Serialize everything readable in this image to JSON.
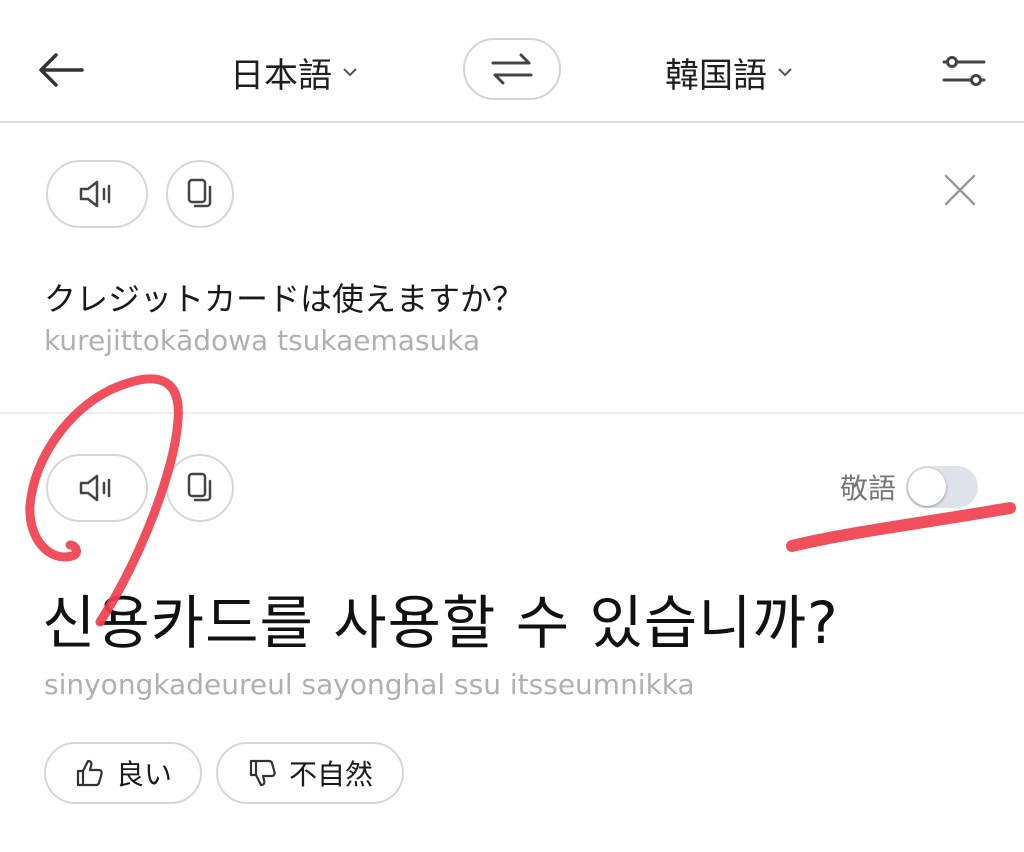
{
  "header": {
    "back_icon": "arrow-left-icon",
    "source_language": "日本語",
    "target_language": "韓国語",
    "swap_icon": "swap-arrows-icon",
    "settings_icon": "sliders-icon"
  },
  "source": {
    "speak_icon": "speaker-icon",
    "copy_icon": "copy-icon",
    "clear_icon": "close-icon",
    "text": "クレジットカードは使えますか？",
    "romanization": "kurejittokādowa tsukaemasuka"
  },
  "result": {
    "speak_icon": "speaker-icon",
    "copy_icon": "copy-icon",
    "honorific_label": "敬語",
    "honorific_enabled": false,
    "text": "신용카드를 사용할 수 있습니까?",
    "romanization": "sinyongkadeureul sayonghal ssu itsseumnikka"
  },
  "feedback": {
    "good_label": "良い",
    "unnatural_label": "不自然"
  },
  "colors": {
    "annotation": "#f0404e",
    "toggle_off": "#dde3e8",
    "muted_text": "#b0b0b0"
  }
}
